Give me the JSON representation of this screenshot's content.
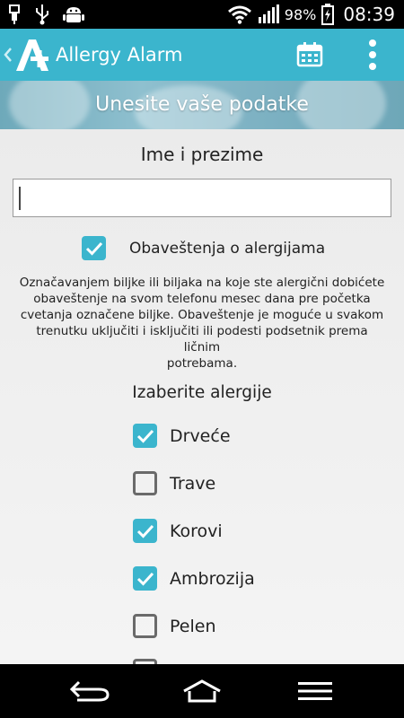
{
  "status_bar": {
    "battery_percent": "98%",
    "time": "08:39",
    "icons": [
      "usb-debug-icon",
      "usb-icon",
      "android-debug-icon",
      "wifi-icon",
      "signal-icon",
      "battery-charging-icon"
    ]
  },
  "app_bar": {
    "title": "Allergy Alarm",
    "actions": [
      "calendar-icon",
      "overflow-menu-icon"
    ]
  },
  "banner": {
    "title": "Unesite vaše podatke"
  },
  "form": {
    "name_label": "Ime i prezime",
    "name_value": "",
    "notifications": {
      "label": "Obaveštenja o alergijama",
      "checked": true
    },
    "description_lines": [
      "Označavanjem biljke ili biljaka na koje ste alergični dobićete",
      "obaveštenje na svom telefonu mesec dana pre početka",
      "cvetanja označene biljke. Obaveštenje je moguće u svakom",
      "trenutku uključiti i isključiti ili podesti podsetnik prema ličnim",
      "potrebama."
    ],
    "allergies_title": "Izaberite alergije",
    "allergies": [
      {
        "label": "Drveće",
        "checked": true
      },
      {
        "label": "Trave",
        "checked": false
      },
      {
        "label": "Korovi",
        "checked": true
      },
      {
        "label": "Ambrozija",
        "checked": true
      },
      {
        "label": "Pelen",
        "checked": false
      }
    ]
  },
  "colors": {
    "accent": "#3bb5cd",
    "checkbox_border": "#6a6a6a"
  },
  "nav_bar": {
    "buttons": [
      "back-icon",
      "home-icon",
      "menu-icon"
    ]
  }
}
